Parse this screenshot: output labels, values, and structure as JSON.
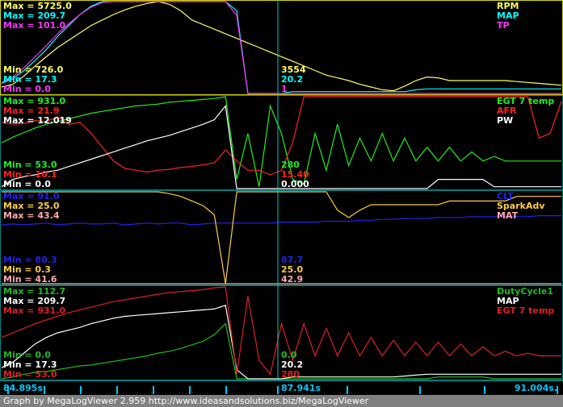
{
  "footer_text": "Graph by MegaLogViewer 2.959 http://www.ideasandsolutions.biz/MegaLogViewer",
  "time_axis": {
    "start_label": "84.895s.",
    "cursor_label": "87.941s",
    "end_label": "91.004s.",
    "start": 84.895,
    "cursor": 87.941,
    "end": 91.004
  },
  "colors": {
    "background": "#000000",
    "panel_border": "#d8d800",
    "separator": "#008080",
    "cursor": "#00c8c8",
    "footer_bg": "#808080",
    "tick": "#00c8ff"
  },
  "chart_data": [
    {
      "type": "line",
      "x_range": [
        84.895,
        91.004
      ],
      "cursor_x": 87.941,
      "series": [
        {
          "name": "RPM",
          "color": "#ffff66",
          "max_label": "Max = 5725.0",
          "min_label": "Min = 726.0",
          "cursor_value": "3554",
          "max": 5725.0,
          "min": 726.0,
          "values": [
            0.07,
            0.1,
            0.19,
            0.3,
            0.4,
            0.5,
            0.58,
            0.66,
            0.74,
            0.8,
            0.86,
            0.91,
            0.95,
            0.98,
            1.0,
            0.97,
            0.9,
            0.8,
            0.75,
            0.7,
            0.65,
            0.6,
            0.55,
            0.5,
            0.45,
            0.4,
            0.35,
            0.3,
            0.25,
            0.2,
            0.17,
            0.14,
            0.1,
            0.07,
            0.04,
            0.03,
            0.08,
            0.14,
            0.18,
            0.17,
            0.14,
            0.14,
            0.14,
            0.14,
            0.14,
            0.14,
            0.13,
            0.12,
            0.11,
            0.1,
            0.09
          ]
        },
        {
          "name": "MAP",
          "color": "#00ffff",
          "max_label": "Max = 209.7",
          "min_label": "Min = 17.3",
          "cursor_value": "20.2",
          "max": 209.7,
          "min": 17.3,
          "values": [
            0.11,
            0.16,
            0.25,
            0.36,
            0.48,
            0.62,
            0.74,
            0.86,
            0.95,
            1.0,
            1.0,
            1.0,
            1.0,
            1.0,
            1.0,
            1.0,
            1.0,
            1.0,
            1.0,
            1.0,
            1.0,
            0.9,
            0.0,
            0.0,
            0.0,
            0.0,
            0.02,
            0.02,
            0.02,
            0.02,
            0.02,
            0.02,
            0.02,
            0.02,
            0.02,
            0.02,
            0.02,
            0.04,
            0.05,
            0.05,
            0.05,
            0.05,
            0.05,
            0.05,
            0.05,
            0.05,
            0.05,
            0.05,
            0.05,
            0.05,
            0.05
          ]
        },
        {
          "name": "TP",
          "color": "#ff33ff",
          "max_label": "Max = 101.0",
          "min_label": "Min = 0.0",
          "cursor_value": "1",
          "max": 101.0,
          "min": 0.0,
          "values": [
            0.12,
            0.18,
            0.28,
            0.4,
            0.52,
            0.65,
            0.76,
            0.86,
            0.94,
            0.99,
            1.0,
            1.0,
            1.0,
            1.0,
            1.0,
            1.0,
            1.0,
            1.0,
            1.0,
            1.0,
            1.0,
            0.85,
            0.0,
            0.0,
            0.0,
            0.0,
            0.0,
            0.0,
            0.0,
            0.0,
            0.0,
            0.0,
            0.0,
            0.0,
            0.0,
            0.0,
            0.0,
            0.0,
            0.0,
            0.0,
            0.0,
            0.0,
            0.0,
            0.0,
            0.0,
            0.0,
            0.0,
            0.0,
            0.0,
            0.0,
            0.0
          ]
        }
      ]
    },
    {
      "type": "line",
      "x_range": [
        84.895,
        91.004
      ],
      "cursor_x": 87.941,
      "series": [
        {
          "name": "EGT 7 temp",
          "color": "#22ee22",
          "max_label": "Max = 931.0",
          "min_label": "Min = 53.0",
          "cursor_value": "280",
          "max": 931.0,
          "min": 53.0,
          "values": [
            0.5,
            0.56,
            0.61,
            0.66,
            0.7,
            0.73,
            0.76,
            0.79,
            0.82,
            0.84,
            0.86,
            0.88,
            0.9,
            0.91,
            0.92,
            0.94,
            0.95,
            0.96,
            0.97,
            0.98,
            1.0,
            0.1,
            0.6,
            0.02,
            0.9,
            0.6,
            0.1,
            0.05,
            0.6,
            0.2,
            0.7,
            0.25,
            0.55,
            0.3,
            0.6,
            0.3,
            0.55,
            0.3,
            0.45,
            0.3,
            0.45,
            0.3,
            0.4,
            0.3,
            0.35,
            0.3,
            0.3,
            0.3,
            0.3,
            0.3,
            0.3
          ]
        },
        {
          "name": "AFR",
          "color": "#ff2222",
          "max_label": "Max = 21.9",
          "min_label": "Min = 10.1",
          "cursor_value": "15.40",
          "max": 21.9,
          "min": 10.1,
          "values": [
            0.72,
            0.7,
            0.71,
            0.74,
            0.73,
            0.78,
            0.7,
            0.72,
            0.6,
            0.45,
            0.3,
            0.22,
            0.2,
            0.18,
            0.2,
            0.21,
            0.23,
            0.24,
            0.26,
            0.28,
            0.42,
            0.3,
            0.2,
            0.2,
            0.15,
            0.2,
            0.5,
            1.0,
            1.0,
            1.0,
            1.0,
            1.0,
            1.0,
            1.0,
            1.0,
            1.0,
            1.0,
            1.0,
            1.0,
            1.0,
            1.0,
            1.0,
            1.0,
            1.0,
            1.0,
            1.0,
            1.0,
            1.0,
            0.55,
            0.6,
            0.95
          ]
        },
        {
          "name": "PW",
          "color": "#ffffff",
          "max_label": "Max = 12.019",
          "min_label": "Min = 0.0",
          "cursor_value": "0.000",
          "max": 12.019,
          "min": 0.0,
          "values": [
            0.02,
            0.1,
            0.13,
            0.15,
            0.18,
            0.2,
            0.24,
            0.28,
            0.32,
            0.36,
            0.4,
            0.44,
            0.48,
            0.52,
            0.55,
            0.58,
            0.62,
            0.66,
            0.7,
            0.75,
            0.9,
            0.0,
            0.0,
            0.0,
            0.0,
            0.0,
            0.0,
            0.0,
            0.0,
            0.0,
            0.0,
            0.0,
            0.0,
            0.0,
            0.0,
            0.0,
            0.0,
            0.0,
            0.0,
            0.1,
            0.1,
            0.1,
            0.1,
            0.1,
            0.02,
            0.02,
            0.02,
            0.02,
            0.02,
            0.02,
            0.02
          ]
        }
      ]
    },
    {
      "type": "line",
      "x_range": [
        84.895,
        91.004
      ],
      "cursor_x": 87.941,
      "series": [
        {
          "name": "CLT",
          "color": "#2222ee",
          "max_label": "Max = 91.0",
          "min_label": "Min = 80.3",
          "cursor_value": "87.7",
          "max": 91.0,
          "min": 80.3,
          "values": [
            0.64,
            0.65,
            0.64,
            0.65,
            0.66,
            0.64,
            0.65,
            0.66,
            0.65,
            0.65,
            0.66,
            0.64,
            0.65,
            0.66,
            0.65,
            0.66,
            0.66,
            0.64,
            0.65,
            0.66,
            0.66,
            0.66,
            0.66,
            0.66,
            0.66,
            0.67,
            0.67,
            0.67,
            0.67,
            0.68,
            0.68,
            0.68,
            0.69,
            0.69,
            0.7,
            0.7,
            0.71,
            0.71,
            0.71,
            0.72,
            0.72,
            0.72,
            0.73,
            0.73,
            0.73,
            0.73,
            0.73,
            0.73,
            0.74,
            0.74,
            0.74
          ]
        },
        {
          "name": "SparkAdv",
          "color": "#ffcc44",
          "max_label": "Max = 25.0",
          "min_label": "Min = 0.3",
          "cursor_value": "25.0",
          "max": 25.0,
          "min": 0.3,
          "values": [
            1.0,
            1.0,
            1.0,
            1.0,
            1.0,
            1.0,
            1.0,
            1.0,
            1.0,
            1.0,
            1.0,
            1.0,
            1.0,
            1.0,
            1.0,
            0.98,
            0.95,
            0.9,
            0.85,
            0.75,
            0.0,
            1.0,
            1.0,
            1.0,
            1.0,
            1.0,
            1.0,
            1.0,
            1.0,
            1.0,
            0.8,
            0.72,
            0.8,
            0.86,
            0.86,
            0.86,
            0.86,
            0.86,
            0.86,
            0.86,
            0.9,
            0.9,
            0.9,
            0.9,
            0.9,
            0.9,
            0.95,
            0.95,
            0.95,
            0.95,
            0.95
          ]
        },
        {
          "name": "MAT",
          "color": "#ffaaaa",
          "max_label": "Max = 43.4",
          "min_label": "Min = 41.6",
          "cursor_value": "42.9",
          "max": 43.4,
          "min": 41.6,
          "values": [
            0.0,
            0.0,
            0.0,
            0.0,
            0.0,
            0.0,
            0.0,
            0.0,
            0.0,
            0.0,
            0.0,
            0.0,
            0.0,
            0.0,
            0.0,
            0.0,
            0.0,
            0.0,
            0.0,
            0.0,
            0.0,
            0.0,
            0.0,
            0.0,
            0.0,
            0.0,
            0.0,
            0.0,
            0.0,
            0.0,
            0.0,
            0.0,
            0.0,
            0.0,
            0.0,
            0.0,
            0.0,
            0.0,
            0.0,
            0.0,
            0.0,
            0.0,
            0.0,
            0.0,
            0.0,
            0.0,
            0.0,
            0.0,
            0.0,
            0.0,
            0.0
          ]
        }
      ]
    },
    {
      "type": "line",
      "x_range": [
        84.895,
        91.004
      ],
      "cursor_x": 87.941,
      "series": [
        {
          "name": "DutyCycle1",
          "color": "#22bb22",
          "max_label": "Max = 112.7",
          "min_label": "Min = 0.0",
          "cursor_value": "0.0",
          "max": 112.7,
          "min": 0.0,
          "values": [
            0.0,
            0.02,
            0.05,
            0.07,
            0.08,
            0.1,
            0.12,
            0.14,
            0.15,
            0.17,
            0.19,
            0.21,
            0.23,
            0.25,
            0.28,
            0.3,
            0.33,
            0.37,
            0.41,
            0.48,
            0.6,
            0.0,
            0.0,
            0.0,
            0.0,
            0.0,
            0.0,
            0.0,
            0.0,
            0.0,
            0.0,
            0.0,
            0.0,
            0.0,
            0.0,
            0.0,
            0.0,
            0.0,
            0.0,
            0.02,
            0.02,
            0.02,
            0.02,
            0.02,
            0.0,
            0.0,
            0.0,
            0.0,
            0.0,
            0.0,
            0.0
          ]
        },
        {
          "name": "MAP",
          "color": "#ffffff",
          "max_label": "Max = 209.7",
          "min_label": "Min = 17.3",
          "cursor_value": "20.2",
          "max": 209.7,
          "min": 17.3,
          "values": [
            0.12,
            0.18,
            0.28,
            0.38,
            0.45,
            0.5,
            0.53,
            0.56,
            0.6,
            0.63,
            0.66,
            0.68,
            0.69,
            0.7,
            0.71,
            0.72,
            0.73,
            0.74,
            0.75,
            0.76,
            0.8,
            0.1,
            0.0,
            0.0,
            0.0,
            0.0,
            0.02,
            0.02,
            0.02,
            0.02,
            0.02,
            0.02,
            0.02,
            0.02,
            0.02,
            0.02,
            0.03,
            0.04,
            0.05,
            0.05,
            0.05,
            0.05,
            0.05,
            0.05,
            0.05,
            0.05,
            0.05,
            0.05,
            0.05,
            0.05,
            0.05
          ]
        },
        {
          "name": "EGT 7 temp",
          "color": "#dd2222",
          "max_label": "Max = 931.0",
          "min_label": "Min = 53.0",
          "cursor_value": "280",
          "max": 931.0,
          "min": 53.0,
          "values": [
            0.45,
            0.5,
            0.55,
            0.6,
            0.64,
            0.68,
            0.72,
            0.75,
            0.78,
            0.81,
            0.84,
            0.86,
            0.88,
            0.9,
            0.92,
            0.94,
            0.95,
            0.96,
            0.97,
            0.99,
            1.0,
            0.05,
            0.9,
            0.2,
            0.05,
            0.6,
            0.2,
            0.6,
            0.25,
            0.55,
            0.25,
            0.5,
            0.25,
            0.45,
            0.25,
            0.42,
            0.25,
            0.4,
            0.25,
            0.4,
            0.25,
            0.38,
            0.25,
            0.35,
            0.25,
            0.3,
            0.25,
            0.28,
            0.25,
            0.25,
            0.25
          ]
        }
      ]
    }
  ]
}
